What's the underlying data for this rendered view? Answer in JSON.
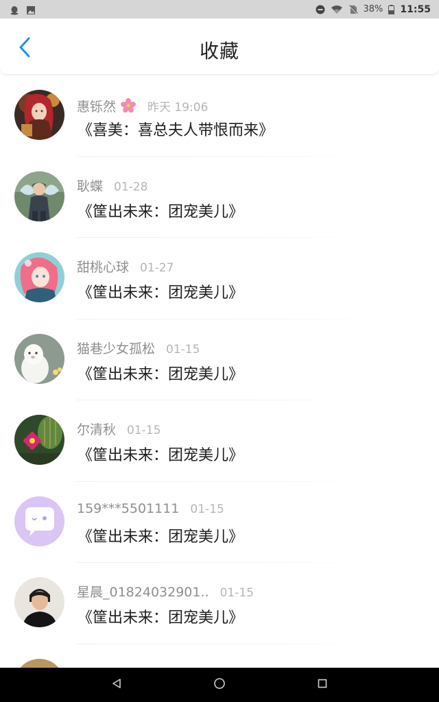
{
  "status_bar": {
    "battery": "38%",
    "time": "11:55",
    "icons": [
      "qq-penguin-icon",
      "image-icon",
      "dnd-icon",
      "wifi-icon",
      "no-sim-icon",
      "battery-icon"
    ]
  },
  "header": {
    "title": "收藏",
    "back_icon": "chevron-left-icon"
  },
  "colors": {
    "accent": "#1e8fe8",
    "name_gray": "#8e8e8e",
    "time_gray": "#b5b5b5",
    "title_text": "#1e1e1e"
  },
  "items": [
    {
      "name": "惠铄然",
      "time": "昨天 19:06",
      "title": "《喜美：喜总夫人带恨而来》",
      "badge": "sakura-flower-icon",
      "avatar": "anime-girl-red-avatar"
    },
    {
      "name": "耿蝶",
      "time": "01-28",
      "title": "《筐出未来：团宠美儿》",
      "avatar": "boy-wings-avatar"
    },
    {
      "name": "甜桃心球",
      "time": "01-27",
      "title": "《筐出未来：团宠美儿》",
      "avatar": "anime-pink-hair-avatar"
    },
    {
      "name": "猫巷少女孤松",
      "time": "01-15",
      "title": "《筐出未来：团宠美儿》",
      "avatar": "white-alpaca-avatar"
    },
    {
      "name": "尔清秋",
      "time": "01-15",
      "title": "《筐出未来：团宠美儿》",
      "avatar": "cactus-flower-avatar"
    },
    {
      "name": "159***5501111",
      "time": "01-15",
      "title": "《筐出未来：团宠美儿》",
      "avatar": "default-chat-bubble-avatar"
    },
    {
      "name": "星晨_01824032901..",
      "time": "01-15",
      "title": "《筐出未来：团宠美儿》",
      "avatar": "person-photo-avatar"
    }
  ],
  "nav": {
    "back": "nav-back-icon",
    "home": "nav-home-icon",
    "recents": "nav-recents-icon"
  }
}
